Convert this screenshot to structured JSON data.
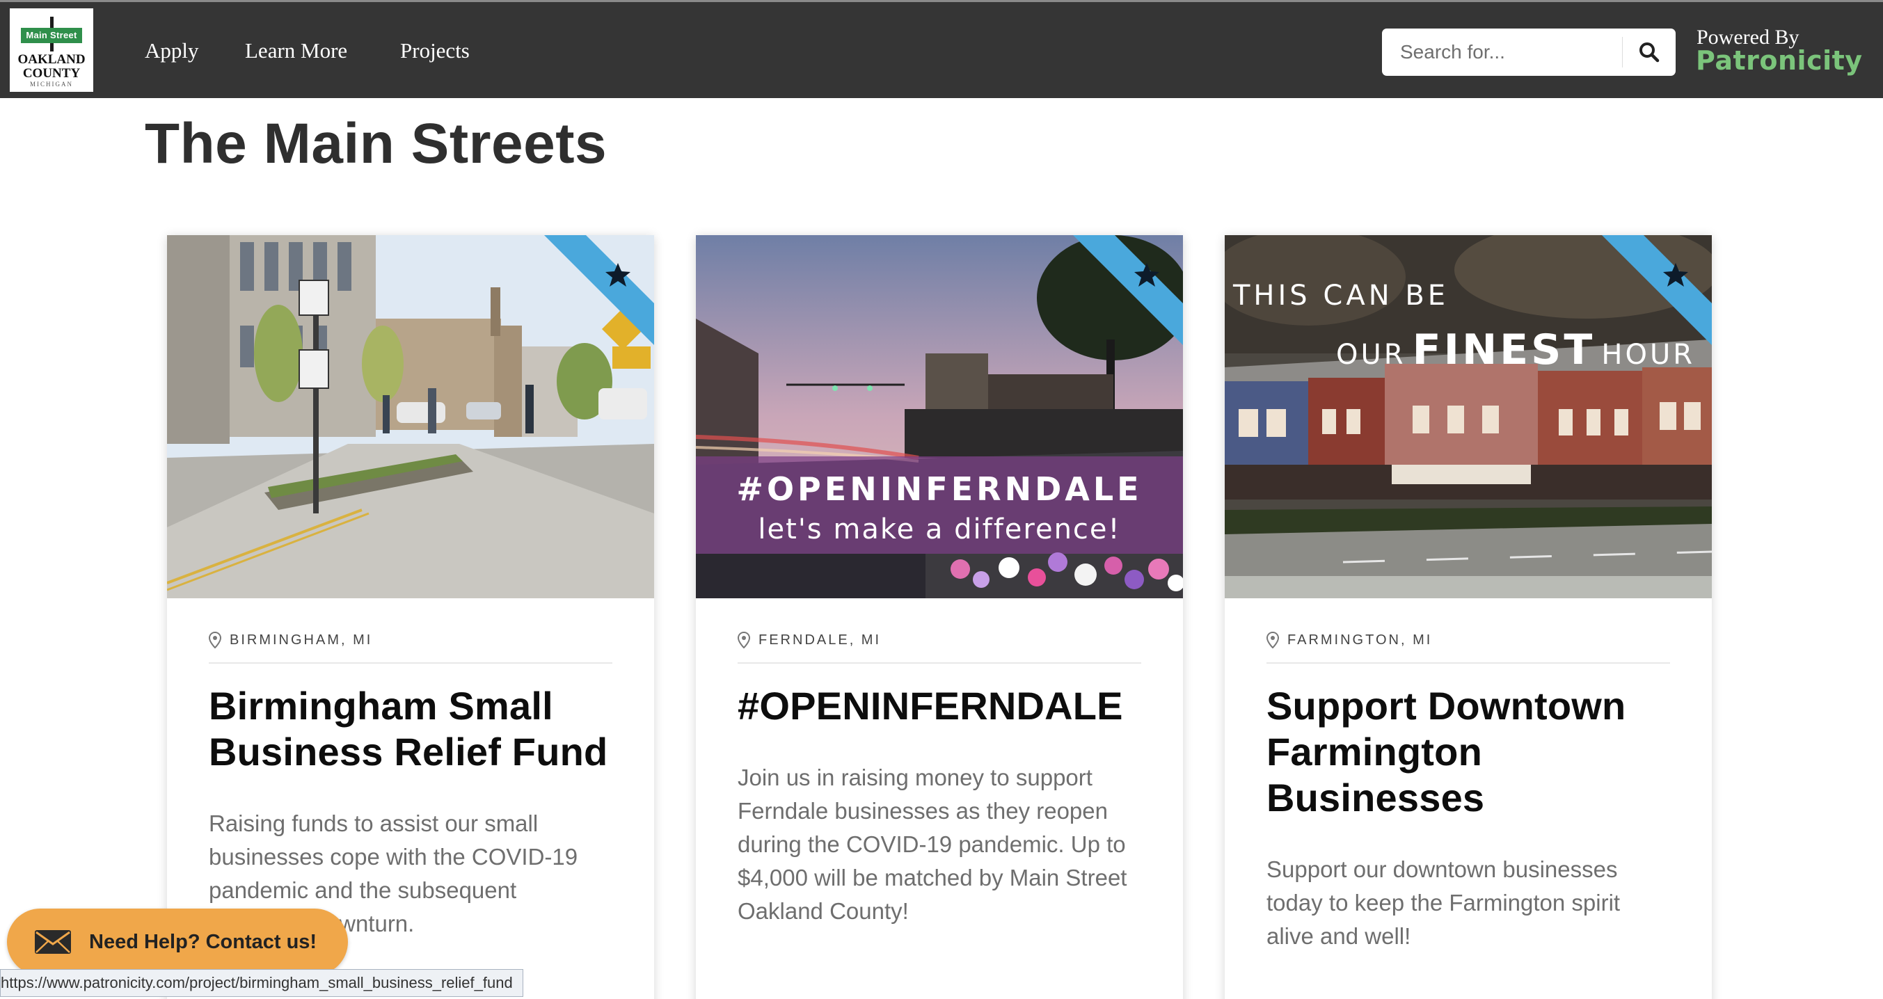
{
  "logo": {
    "sign_text": "Main Street",
    "line1": "OAKLAND",
    "line2": "COUNTY",
    "line3": "MICHIGAN"
  },
  "nav": {
    "items": [
      {
        "label": "Apply"
      },
      {
        "label": "Learn More"
      },
      {
        "label": "Projects"
      }
    ]
  },
  "search": {
    "placeholder": "Search for...",
    "icon": "search-icon"
  },
  "powered_by": {
    "label": "Powered By",
    "brand": "Patronicity",
    "brand_color": "#7bc47b"
  },
  "page": {
    "title": "The Main Streets"
  },
  "cards": [
    {
      "location": "BIRMINGHAM, MI",
      "title": "Birmingham Small Business Relief Fund",
      "description": "Raising funds to assist our small businesses cope with the COVID-19 pandemic and the subsequent economic downturn.",
      "featured": true
    },
    {
      "location": "FERNDALE, MI",
      "title": "#OPENINFERNDALE",
      "description": "Join us in raising money to support Ferndale businesses as they reopen during the COVID-19 pandemic. Up to $4,000 will be matched by Main Street Oakland County!",
      "image_overlay": {
        "headline": "#OPENINFERNDALE",
        "subline": "let's make a difference!"
      },
      "featured": true
    },
    {
      "location": "FARMINGTON, MI",
      "title": "Support Downtown Farmington Businesses",
      "description": "Support our downtown businesses today to keep the Farmington spirit alive and well!",
      "image_overlay": {
        "line1": "THIS CAN BE",
        "line2_a": "OUR",
        "line2_b": "FINEST",
        "line2_c": "HOUR"
      },
      "featured": true
    }
  ],
  "help": {
    "label": "Need Help? Contact us!",
    "icon": "envelope-icon"
  },
  "status_bar": {
    "url": "https://www.patronicity.com/project/birmingham_small_business_relief_fund"
  },
  "colors": {
    "navbar": "#353535",
    "ribbon": "#4aa8dc",
    "help_button": "#f0a74a"
  }
}
